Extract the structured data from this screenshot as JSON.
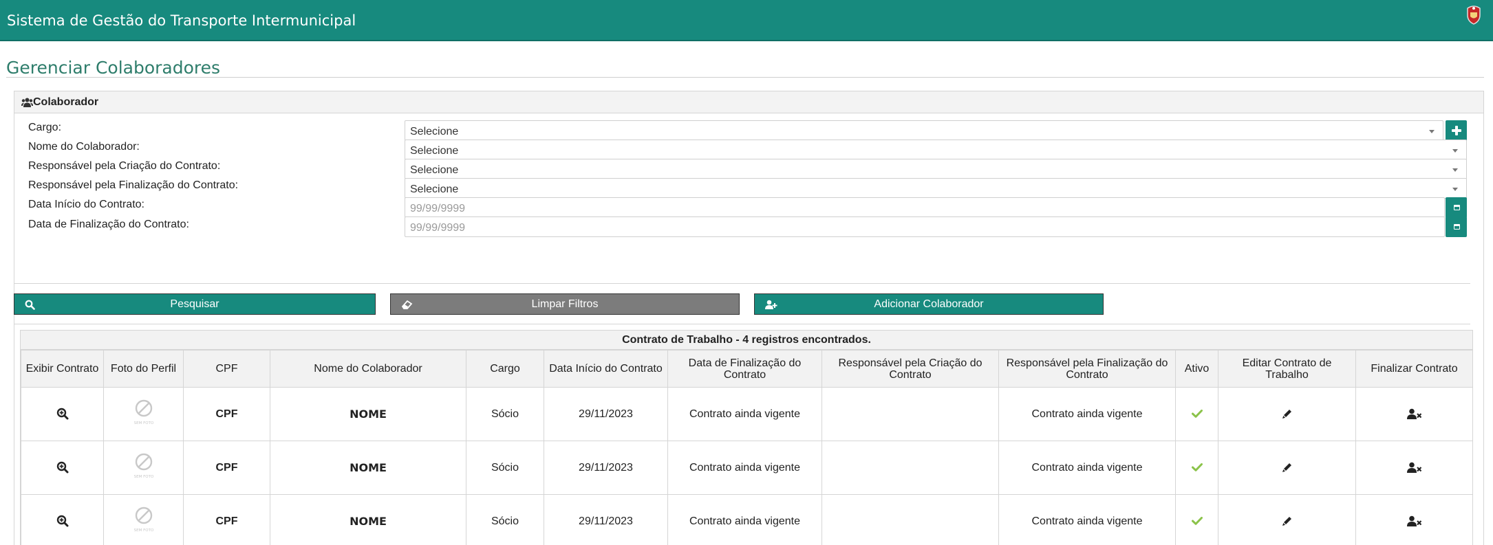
{
  "header": {
    "app_title": "Sistema de Gestão do Transporte Intermunicipal"
  },
  "page": {
    "title": "Gerenciar Colaboradores"
  },
  "panel": {
    "label": "Colaborador"
  },
  "filters": {
    "cargo_label": "Cargo:",
    "cargo_value": "Selecione",
    "nome_label": "Nome do Colaborador:",
    "nome_value": "Selecione",
    "resp_criacao_label": "Responsável pela Criação do Contrato:",
    "resp_criacao_value": "Selecione",
    "resp_finalizacao_label": "Responsável pela Finalização do Contrato:",
    "resp_finalizacao_value": "Selecione",
    "data_inicio_label": "Data Início do Contrato:",
    "data_inicio_placeholder": "99/99/9999",
    "data_final_label": "Data de Finalização do Contrato:",
    "data_final_placeholder": "99/99/9999"
  },
  "actions": {
    "search_label": "Pesquisar",
    "clear_label": "Limpar Filtros",
    "add_label": "Adicionar Colaborador"
  },
  "table": {
    "caption": "Contrato de Trabalho - 4 registros encontrados.",
    "columns": [
      "Exibir Contrato",
      "Foto do Perfil",
      "CPF",
      "Nome do Colaborador",
      "Cargo",
      "Data Início do Contrato",
      "Data de Finalização do Contrato",
      "Responsável pela Criação do Contrato",
      "Responsável pela Finalização do Contrato",
      "Ativo",
      "Editar Contrato de Trabalho",
      "Finalizar Contrato"
    ],
    "photo_caption": "SEM FOTO",
    "rows": [
      {
        "cpf": "CPF",
        "nome": "NOME",
        "cargo": "Sócio",
        "data_inicio": "29/11/2023",
        "data_final": "Contrato ainda vigente",
        "resp_criacao": "",
        "resp_finalizacao": "Contrato ainda vigente"
      },
      {
        "cpf": "CPF",
        "nome": "NOME",
        "cargo": "Sócio",
        "data_inicio": "29/11/2023",
        "data_final": "Contrato ainda vigente",
        "resp_criacao": "",
        "resp_finalizacao": "Contrato ainda vigente"
      },
      {
        "cpf": "CPF",
        "nome": "NOME",
        "cargo": "Sócio",
        "data_inicio": "29/11/2023",
        "data_final": "Contrato ainda vigente",
        "resp_criacao": "",
        "resp_finalizacao": "Contrato ainda vigente"
      }
    ]
  },
  "icons": {
    "crest": "state-crest-icon",
    "panel": "users-icon",
    "add_cargo": "plus-icon",
    "calendar": "calendar-icon",
    "search": "search-icon",
    "clear": "eraser-icon",
    "add_user": "user-plus-icon",
    "view": "zoom-in-icon",
    "photo": "no-photo-icon",
    "active": "check-icon",
    "edit": "pencil-icon",
    "finalize": "user-remove-icon"
  },
  "colors": {
    "brand": "#178a7e",
    "title": "#2e7d6b",
    "clear_button": "#7c7c7c",
    "check": "#8bc34a"
  }
}
